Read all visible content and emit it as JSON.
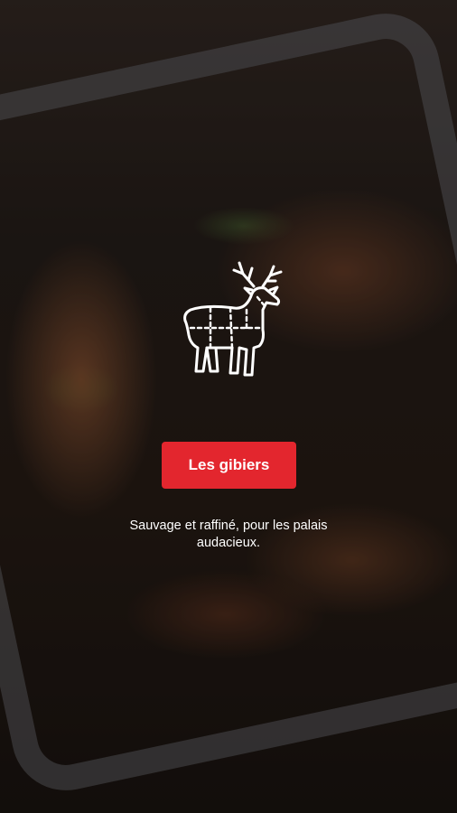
{
  "hero": {
    "background_description": "roasted game meat in a metal tray",
    "icon": "deer-butcher-cuts-icon",
    "button_label": "Les gibiers",
    "tagline": "Sauvage et raffiné, pour les palais audacieux."
  },
  "colors": {
    "accent": "#e3262e",
    "text": "#ffffff"
  }
}
